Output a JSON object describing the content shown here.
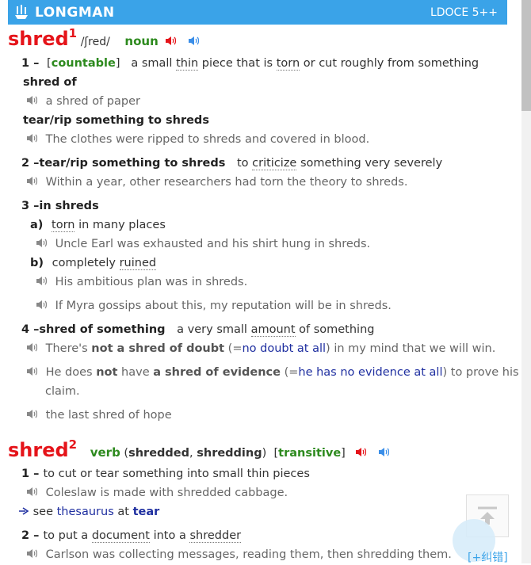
{
  "header": {
    "brand": "LONGMAN",
    "edition": "LDOCE 5++"
  },
  "entry1": {
    "word": "shred",
    "homnum": "1",
    "pron": "/ʃred/",
    "pos": "noun",
    "s1": {
      "num": "1",
      "gram": "countable",
      "def_a": "a small ",
      "def_thin": "thin",
      "def_b": " piece that is ",
      "def_torn": "torn",
      "def_c": " or cut roughly from something",
      "lex1": "shred of",
      "ex1": "a shred of paper",
      "lex2": "tear/rip something to shreds",
      "ex2": "The clothes were ripped to shreds and covered in blood."
    },
    "s2": {
      "num": "2",
      "lex": "tear/rip something to shreds",
      "def_a": "to ",
      "def_criticize": "criticize",
      "def_b": " something very severely",
      "ex": "Within a year, other researchers had torn the theory to shreds."
    },
    "s3": {
      "num": "3",
      "lex": "in shreds",
      "a_label": "a)",
      "a_torn": "torn",
      "a_def": " in many places",
      "a_ex": "Uncle Earl was exhausted and his shirt hung in shreds.",
      "b_label": "b)",
      "b_def": "completely ",
      "b_ruined": "ruined",
      "b_ex1": "His ambitious plan was in shreds.",
      "b_ex2": "If Myra gossips about this, my reputation will be in shreds."
    },
    "s4": {
      "num": "4",
      "lex": "shred of something",
      "def_a": "a very small ",
      "def_amount": "amount",
      "def_b": " of something",
      "ex1_a": "There's ",
      "ex1_b": "not a shred of doubt",
      "ex1_c": " (=",
      "ex1_d": "no doubt at all",
      "ex1_e": ") in my mind that we will win.",
      "ex2_a": "He does ",
      "ex2_b": "not",
      "ex2_c": " have ",
      "ex2_d": "a shred of evidence",
      "ex2_e": " (=",
      "ex2_f": "he has no evidence at all",
      "ex2_g": ") to prove his",
      "ex2_h": "claim.",
      "ex3": "the last shred of hope"
    }
  },
  "entry2": {
    "word": "shred",
    "homnum": "2",
    "pos": "verb",
    "forms_open": " (",
    "form1": "shredded",
    "comma": ", ",
    "form2": "shredding",
    "forms_close": ")",
    "gram": "transitive",
    "s1": {
      "num": "1",
      "def": "to cut or tear something into small thin pieces",
      "ex": "Coleslaw is made with shredded cabbage.",
      "thes_a": "see ",
      "thes_b": "thesaurus",
      "thes_c": " at ",
      "thes_d": "tear"
    },
    "s2": {
      "num": "2",
      "def_a": "to put a ",
      "def_document": "document",
      "def_b": " into a ",
      "def_shredder": "shredder",
      "ex": "Carlson was collecting messages, reading them, then shredding them."
    }
  },
  "footer": {
    "report": "[+纠错]"
  },
  "colors": {
    "header": "#3aa3e8",
    "headword": "#e5141a",
    "grammar": "#2d8a1e",
    "link": "#1f2fa0"
  }
}
